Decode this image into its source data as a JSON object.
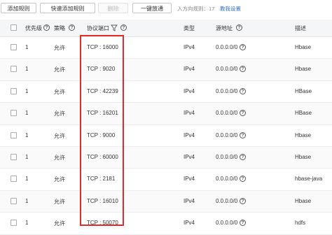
{
  "toolbar": {
    "add_rule": "添加规则",
    "quick_add_rule": "快速添加规则",
    "delete": "删除",
    "one_click_allow": "一键放通",
    "inbound_rules_label": "入方向规则：",
    "inbound_rules_count": "17",
    "tutorial_link": "教我设置"
  },
  "columns": {
    "priority": "优先级",
    "policy": "策略",
    "protocol_port": "协议端口",
    "type": "类型",
    "source_address": "源地址",
    "description": "描述"
  },
  "rows": [
    {
      "priority": "1",
      "policy": "允许",
      "protocol_port": "TCP : 16000",
      "type": "IPv4",
      "source": "0.0.0.0/0",
      "description": "Hbase"
    },
    {
      "priority": "1",
      "policy": "允许",
      "protocol_port": "TCP : 9020",
      "type": "IPv4",
      "source": "0.0.0.0/0",
      "description": "Hbase"
    },
    {
      "priority": "1",
      "policy": "允许",
      "protocol_port": "TCP : 42239",
      "type": "IPv4",
      "source": "0.0.0.0/0",
      "description": "HBase"
    },
    {
      "priority": "1",
      "policy": "允许",
      "protocol_port": "TCP : 16201",
      "type": "IPv4",
      "source": "0.0.0.0/0",
      "description": "HBase"
    },
    {
      "priority": "1",
      "policy": "允许",
      "protocol_port": "TCP : 9000",
      "type": "IPv4",
      "source": "0.0.0.0/0",
      "description": "Hbase"
    },
    {
      "priority": "1",
      "policy": "允许",
      "protocol_port": "TCP : 60000",
      "type": "IPv4",
      "source": "0.0.0.0/0",
      "description": "Hbase"
    },
    {
      "priority": "1",
      "policy": "允许",
      "protocol_port": "TCP : 2181",
      "type": "IPv4",
      "source": "0.0.0.0/0",
      "description": "hbase-java"
    },
    {
      "priority": "1",
      "policy": "允许",
      "protocol_port": "TCP : 16010",
      "type": "IPv4",
      "source": "0.0.0.0/0",
      "description": "Hbase"
    },
    {
      "priority": "1",
      "policy": "允许",
      "protocol_port": "TCP : 50070",
      "type": "IPv4",
      "source": "0.0.0.0/0",
      "description": "hdfs"
    }
  ],
  "icons": {
    "help": "question-circle-icon",
    "filter": "filter-icon"
  },
  "colors": {
    "highlight": "#e32b2b",
    "link": "#2f6fd6",
    "header_bg": "#f5f6f8"
  }
}
